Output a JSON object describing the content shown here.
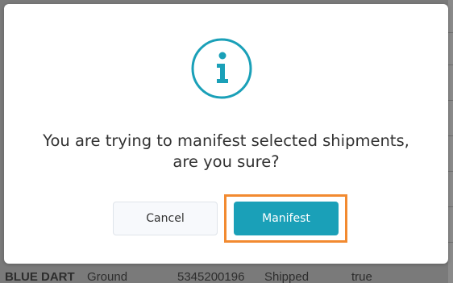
{
  "dialog": {
    "icon": "info-icon",
    "message_line1": "You are trying to manifest selected shipments,",
    "message_line2": "are you sure?",
    "cancel_label": "Cancel",
    "confirm_label": "Manifest"
  },
  "backdrop_row": {
    "carrier": "BLUE DART",
    "mode": "Ground",
    "awb": "5345200196",
    "status": "Shipped",
    "flag": "true"
  },
  "colors": {
    "accent": "#1aa0b8",
    "highlight": "#f28a30",
    "text": "#333333"
  }
}
